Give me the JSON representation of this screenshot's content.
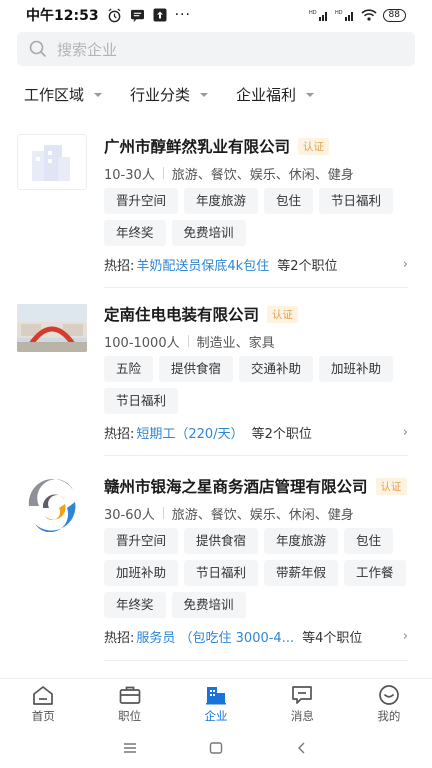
{
  "status_bar": {
    "time": "中午12:53",
    "battery": "88",
    "more": "···"
  },
  "search": {
    "placeholder": "搜索企业"
  },
  "filters": [
    "工作区域",
    "行业分类",
    "企业福利"
  ],
  "companies": [
    {
      "name": "广州市醇鲜然乳业有限公司",
      "badge": "认证",
      "size": "10-30人",
      "industry": "旅游、餐饮、娱乐、休闲、健身",
      "tags": [
        "晋升空间",
        "年度旅游",
        "包住",
        "节日福利",
        "年终奖",
        "免费培训"
      ],
      "hot_label": "热招:",
      "hot_job": "羊奶配送员保底4k包住",
      "hot_count": "等2个职位"
    },
    {
      "name": "定南住电电装有限公司",
      "badge": "认证",
      "size": "100-1000人",
      "industry": "制造业、家具",
      "tags": [
        "五险",
        "提供食宿",
        "交通补助",
        "加班补助",
        "节日福利"
      ],
      "hot_label": "热招:",
      "hot_job": "短期工（220/天）",
      "hot_count": "等2个职位"
    },
    {
      "name": "赣州市银海之星商务酒店管理有限公司",
      "badge": "认证",
      "size": "30-60人",
      "industry": "旅游、餐饮、娱乐、休闲、健身",
      "tags": [
        "晋升空间",
        "提供食宿",
        "年度旅游",
        "包住",
        "加班补助",
        "节日福利",
        "带薪年假",
        "工作餐",
        "年终奖",
        "免费培训"
      ],
      "hot_label": "热招:",
      "hot_job": "服务员 （包吃住 3000-4...",
      "hot_count": "等4个职位"
    }
  ],
  "tabbar": [
    {
      "label": "首页",
      "icon": "home-icon",
      "active": false
    },
    {
      "label": "职位",
      "icon": "briefcase-icon",
      "active": false
    },
    {
      "label": "企业",
      "icon": "company-icon",
      "active": true
    },
    {
      "label": "消息",
      "icon": "message-icon",
      "active": false
    },
    {
      "label": "我的",
      "icon": "profile-icon",
      "active": false
    }
  ],
  "colors": {
    "accent": "#1a73d9",
    "link": "#2e86d6",
    "badge": "#e2a24c"
  }
}
